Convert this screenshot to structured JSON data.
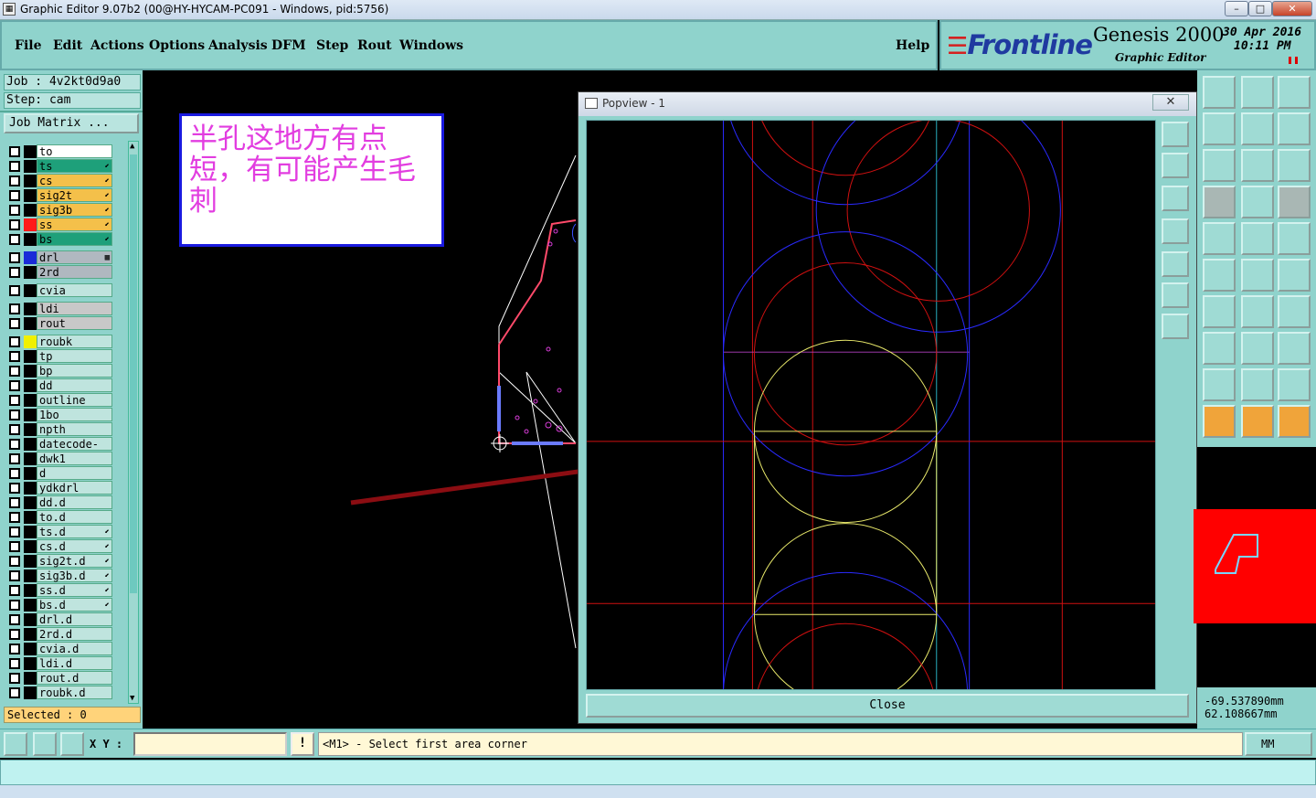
{
  "window": {
    "title": "Graphic Editor 9.07b2 (00@HY-HYCAM-PC091 - Windows, pid:5756)",
    "buttons": {
      "minimize": "–",
      "maximize": "□",
      "close": "✕"
    }
  },
  "menu": {
    "items": [
      "File",
      "Edit",
      "Actions",
      "Options",
      "Analysis",
      "DFM",
      "Step",
      "Rout",
      "Windows"
    ],
    "help": "Help"
  },
  "brand": {
    "logo": "Frontline",
    "product": "Genesis 2000",
    "subtitle": "Graphic Editor",
    "date": "30 Apr 2016",
    "time": "10:11 PM"
  },
  "job": {
    "job_line": "Job : 4v2kt0d9a0",
    "step_line": "Step: cam",
    "matrix_button": "Job Matrix ..."
  },
  "layers": [
    {
      "name": "to",
      "color": "#000000",
      "bg": "#ffffff",
      "flag": ""
    },
    {
      "name": "ts",
      "color": "#000000",
      "bg": "#1ea07a",
      "flag": "⬋"
    },
    {
      "name": "cs",
      "color": "#000000",
      "bg": "#f4c04a",
      "flag": "⬋"
    },
    {
      "name": "sig2t",
      "color": "#000000",
      "bg": "#f4c04a",
      "flag": "⬋"
    },
    {
      "name": "sig3b",
      "color": "#000000",
      "bg": "#f4c04a",
      "flag": "⬋"
    },
    {
      "name": "ss",
      "color": "#ff1a1a",
      "bg": "#f4c04a",
      "flag": "⬋"
    },
    {
      "name": "bs",
      "color": "#000000",
      "bg": "#1ea07a",
      "flag": "⬋"
    },
    {
      "name": "drl",
      "color": "#1a2bd8",
      "bg": "#b0b8c0",
      "flag": "▦"
    },
    {
      "name": "2rd",
      "color": "#000000",
      "bg": "#b0b8c0",
      "flag": ""
    },
    {
      "name": "cvia",
      "color": "#000000",
      "bg": "#bfe4de",
      "flag": ""
    },
    {
      "name": "ldi",
      "color": "#000000",
      "bg": "#c8c8c8",
      "flag": ""
    },
    {
      "name": "rout",
      "color": "#000000",
      "bg": "#c8c8c8",
      "flag": ""
    },
    {
      "name": "roubk",
      "color": "#f0f000",
      "bg": "#bfe4de",
      "flag": ""
    },
    {
      "name": "tp",
      "color": "#000000",
      "bg": "#bfe4de",
      "flag": ""
    },
    {
      "name": "bp",
      "color": "#000000",
      "bg": "#bfe4de",
      "flag": ""
    },
    {
      "name": "dd",
      "color": "#000000",
      "bg": "#bfe4de",
      "flag": ""
    },
    {
      "name": "outline",
      "color": "#000000",
      "bg": "#bfe4de",
      "flag": ""
    },
    {
      "name": "1bo",
      "color": "#000000",
      "bg": "#bfe4de",
      "flag": ""
    },
    {
      "name": "npth",
      "color": "#000000",
      "bg": "#bfe4de",
      "flag": ""
    },
    {
      "name": "datecode-bs",
      "color": "#000000",
      "bg": "#bfe4de",
      "flag": ""
    },
    {
      "name": "dwk1",
      "color": "#000000",
      "bg": "#bfe4de",
      "flag": ""
    },
    {
      "name": "d",
      "color": "#000000",
      "bg": "#bfe4de",
      "flag": ""
    },
    {
      "name": "ydkdrl",
      "color": "#000000",
      "bg": "#bfe4de",
      "flag": ""
    },
    {
      "name": "dd.d",
      "color": "#000000",
      "bg": "#bfe4de",
      "flag": ""
    },
    {
      "name": "to.d",
      "color": "#000000",
      "bg": "#bfe4de",
      "flag": ""
    },
    {
      "name": "ts.d",
      "color": "#000000",
      "bg": "#bfe4de",
      "flag": "⬋"
    },
    {
      "name": "cs.d",
      "color": "#000000",
      "bg": "#bfe4de",
      "flag": "⬋"
    },
    {
      "name": "sig2t.d",
      "color": "#000000",
      "bg": "#bfe4de",
      "flag": "⬋"
    },
    {
      "name": "sig3b.d",
      "color": "#000000",
      "bg": "#bfe4de",
      "flag": "⬋"
    },
    {
      "name": "ss.d",
      "color": "#000000",
      "bg": "#bfe4de",
      "flag": "⬋"
    },
    {
      "name": "bs.d",
      "color": "#000000",
      "bg": "#bfe4de",
      "flag": "⬋"
    },
    {
      "name": "drl.d",
      "color": "#000000",
      "bg": "#bfe4de",
      "flag": ""
    },
    {
      "name": "2rd.d",
      "color": "#000000",
      "bg": "#bfe4de",
      "flag": ""
    },
    {
      "name": "cvia.d",
      "color": "#000000",
      "bg": "#bfe4de",
      "flag": ""
    },
    {
      "name": "ldi.d",
      "color": "#000000",
      "bg": "#bfe4de",
      "flag": ""
    },
    {
      "name": "rout.d",
      "color": "#000000",
      "bg": "#bfe4de",
      "flag": ""
    },
    {
      "name": "roubk.d",
      "color": "#000000",
      "bg": "#bfe4de",
      "flag": ""
    }
  ],
  "selected": "Selected : 0",
  "annotation": "半孔这地方有点短，有可能产生毛刺",
  "popview": {
    "title": "Popview - 1",
    "close_x": "✕",
    "close_button": "Close"
  },
  "coords": {
    "x": "-69.537890mm",
    "y": "62.108667mm"
  },
  "status": {
    "xy_label": "X Y :",
    "xy_value": "",
    "warn": "!",
    "prompt": "<M1> - Select first area corner",
    "units": "MM"
  },
  "colors": {
    "panel": "#8fd3cc",
    "annotation_text": "#e23de0",
    "arrow": "#8b0d12"
  }
}
